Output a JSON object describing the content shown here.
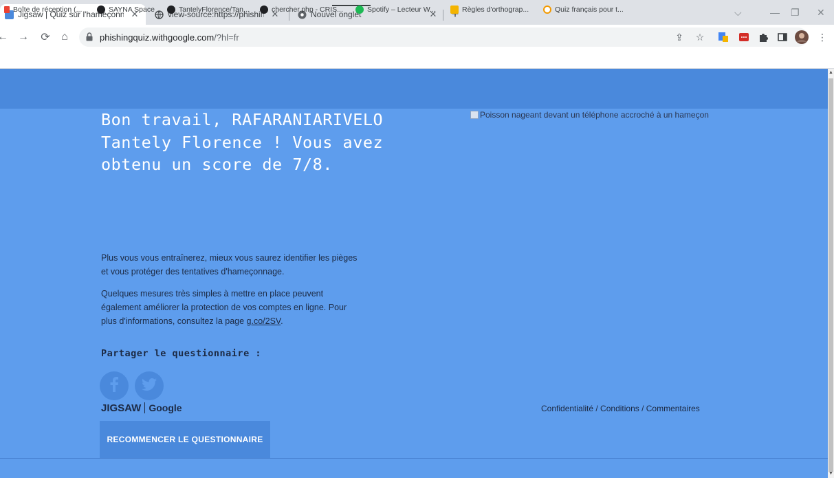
{
  "tabs": [
    {
      "title": "Jigsaw | Quiz sur l'hameçonnage",
      "icon": "jigsaw-favicon",
      "active": true
    },
    {
      "title": "view-source:https://phishingquiz",
      "icon": "globe-icon",
      "active": false
    },
    {
      "title": "Nouvel onglet",
      "icon": "chrome-favicon",
      "active": false
    }
  ],
  "toolbar": {
    "url_host": "phishingquiz.withgoogle.com",
    "url_path": "/?hl=fr"
  },
  "bookmarks": [
    {
      "label": "Boîte de réception (...",
      "color": "#ea4335"
    },
    {
      "label": "SAYNA Space",
      "color": "#202124"
    },
    {
      "label": "TantelyFlorence/Tan...",
      "color": "#202124"
    },
    {
      "label": "chercher.php - CRIS...",
      "color": "#202124"
    },
    {
      "label": "Spotify – Lecteur W...",
      "color": "#1db954"
    },
    {
      "label": "Règles d'orthograp...",
      "color": "#f4b400"
    },
    {
      "label": "Quiz français pour t...",
      "color": "#f29900"
    }
  ],
  "page": {
    "heading": "Bon travail, RAFARANIARIVELO Tantely Florence ! Vous avez obtenu un score de 7/8.",
    "para1": "Plus vous vous entraînerez, mieux vous saurez identifier les pièges et vous protéger des tentatives d'hameçonnage.",
    "para2_prefix": "Quelques mesures très simples à mettre en place peuvent également améliorer la protection de vos comptes en ligne. Pour plus d'informations, consultez la page ",
    "para2_link": "g.co/2SV",
    "para2_suffix": ".",
    "share_label": "Partager le questionnaire :",
    "restart_label": "RECOMMENCER LE QUESTIONNAIRE",
    "image_alt": "Poisson nageant devant un téléphone accroché à un hameçon",
    "footer_logo": "JIGSAW",
    "footer_logo2": "Google",
    "footer_links": "Confidentialité / Conditions / Commentaires"
  },
  "colors": {
    "page_bg": "#5e9ded",
    "header_bg": "#4a89dc",
    "button_bg": "#4a89dc",
    "heading_text": "#ffffff",
    "body_text": "#1c2a44"
  }
}
